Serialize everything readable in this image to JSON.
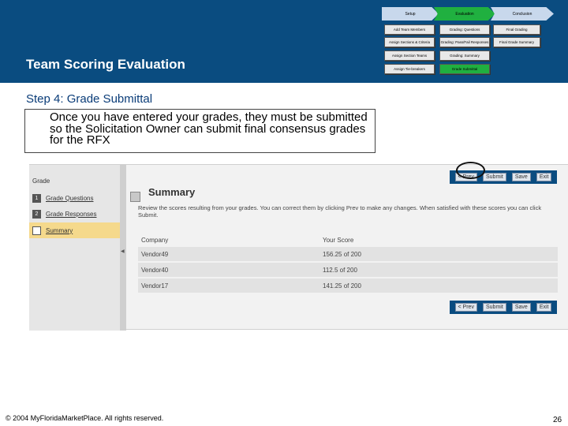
{
  "header": {
    "title": "Team Scoring Evaluation"
  },
  "flow": {
    "phases": [
      "Setup",
      "Evaluation",
      "Conclusion"
    ],
    "steps": {
      "setup": [
        "Add Team Members",
        "Assign Sections & Criteria",
        "Assign Section Teams",
        "Assign Tie-breakers"
      ],
      "evaluation": [
        "Grading: Questions",
        "Grading: Pass/Fail Responses",
        "Grading: Summary",
        "Grade Submittal"
      ],
      "conclusion": [
        "Final Grading",
        "Final Grade Summary"
      ]
    },
    "colors": {
      "active": "#20b040",
      "inactive": "#e8e8e8",
      "header": "#0a4c80"
    }
  },
  "step": {
    "heading": "Step 4: Grade Submittal",
    "callout": "Once you have entered your grades, they must be submitted so the Solicitation Owner can submit final consensus grades for the RFX"
  },
  "screen": {
    "sidebar": {
      "heading": "Grade",
      "items": [
        {
          "num": "1",
          "label": "Grade Questions"
        },
        {
          "num": "2",
          "label": "Grade Responses"
        },
        {
          "num": "",
          "label": "Summary"
        }
      ]
    },
    "buttons": [
      "< Prev",
      "Submit",
      "Save",
      "Exit"
    ],
    "summary": {
      "title": "Summary",
      "description": "Review the scores resulting from your grades. You can correct them by clicking Prev to make any changes. When satisfied with these scores you can click Submit."
    },
    "table": {
      "headers": [
        "Company",
        "Your Score"
      ],
      "rows": [
        {
          "company": "Vendor49",
          "score": "156.25 of 200"
        },
        {
          "company": "Vendor40",
          "score": "112.5 of 200"
        },
        {
          "company": "Vendor17",
          "score": "141.25 of 200"
        }
      ]
    }
  },
  "footer": {
    "copyright": "© 2004 MyFloridaMarketPlace. All rights reserved.",
    "page": "26"
  }
}
